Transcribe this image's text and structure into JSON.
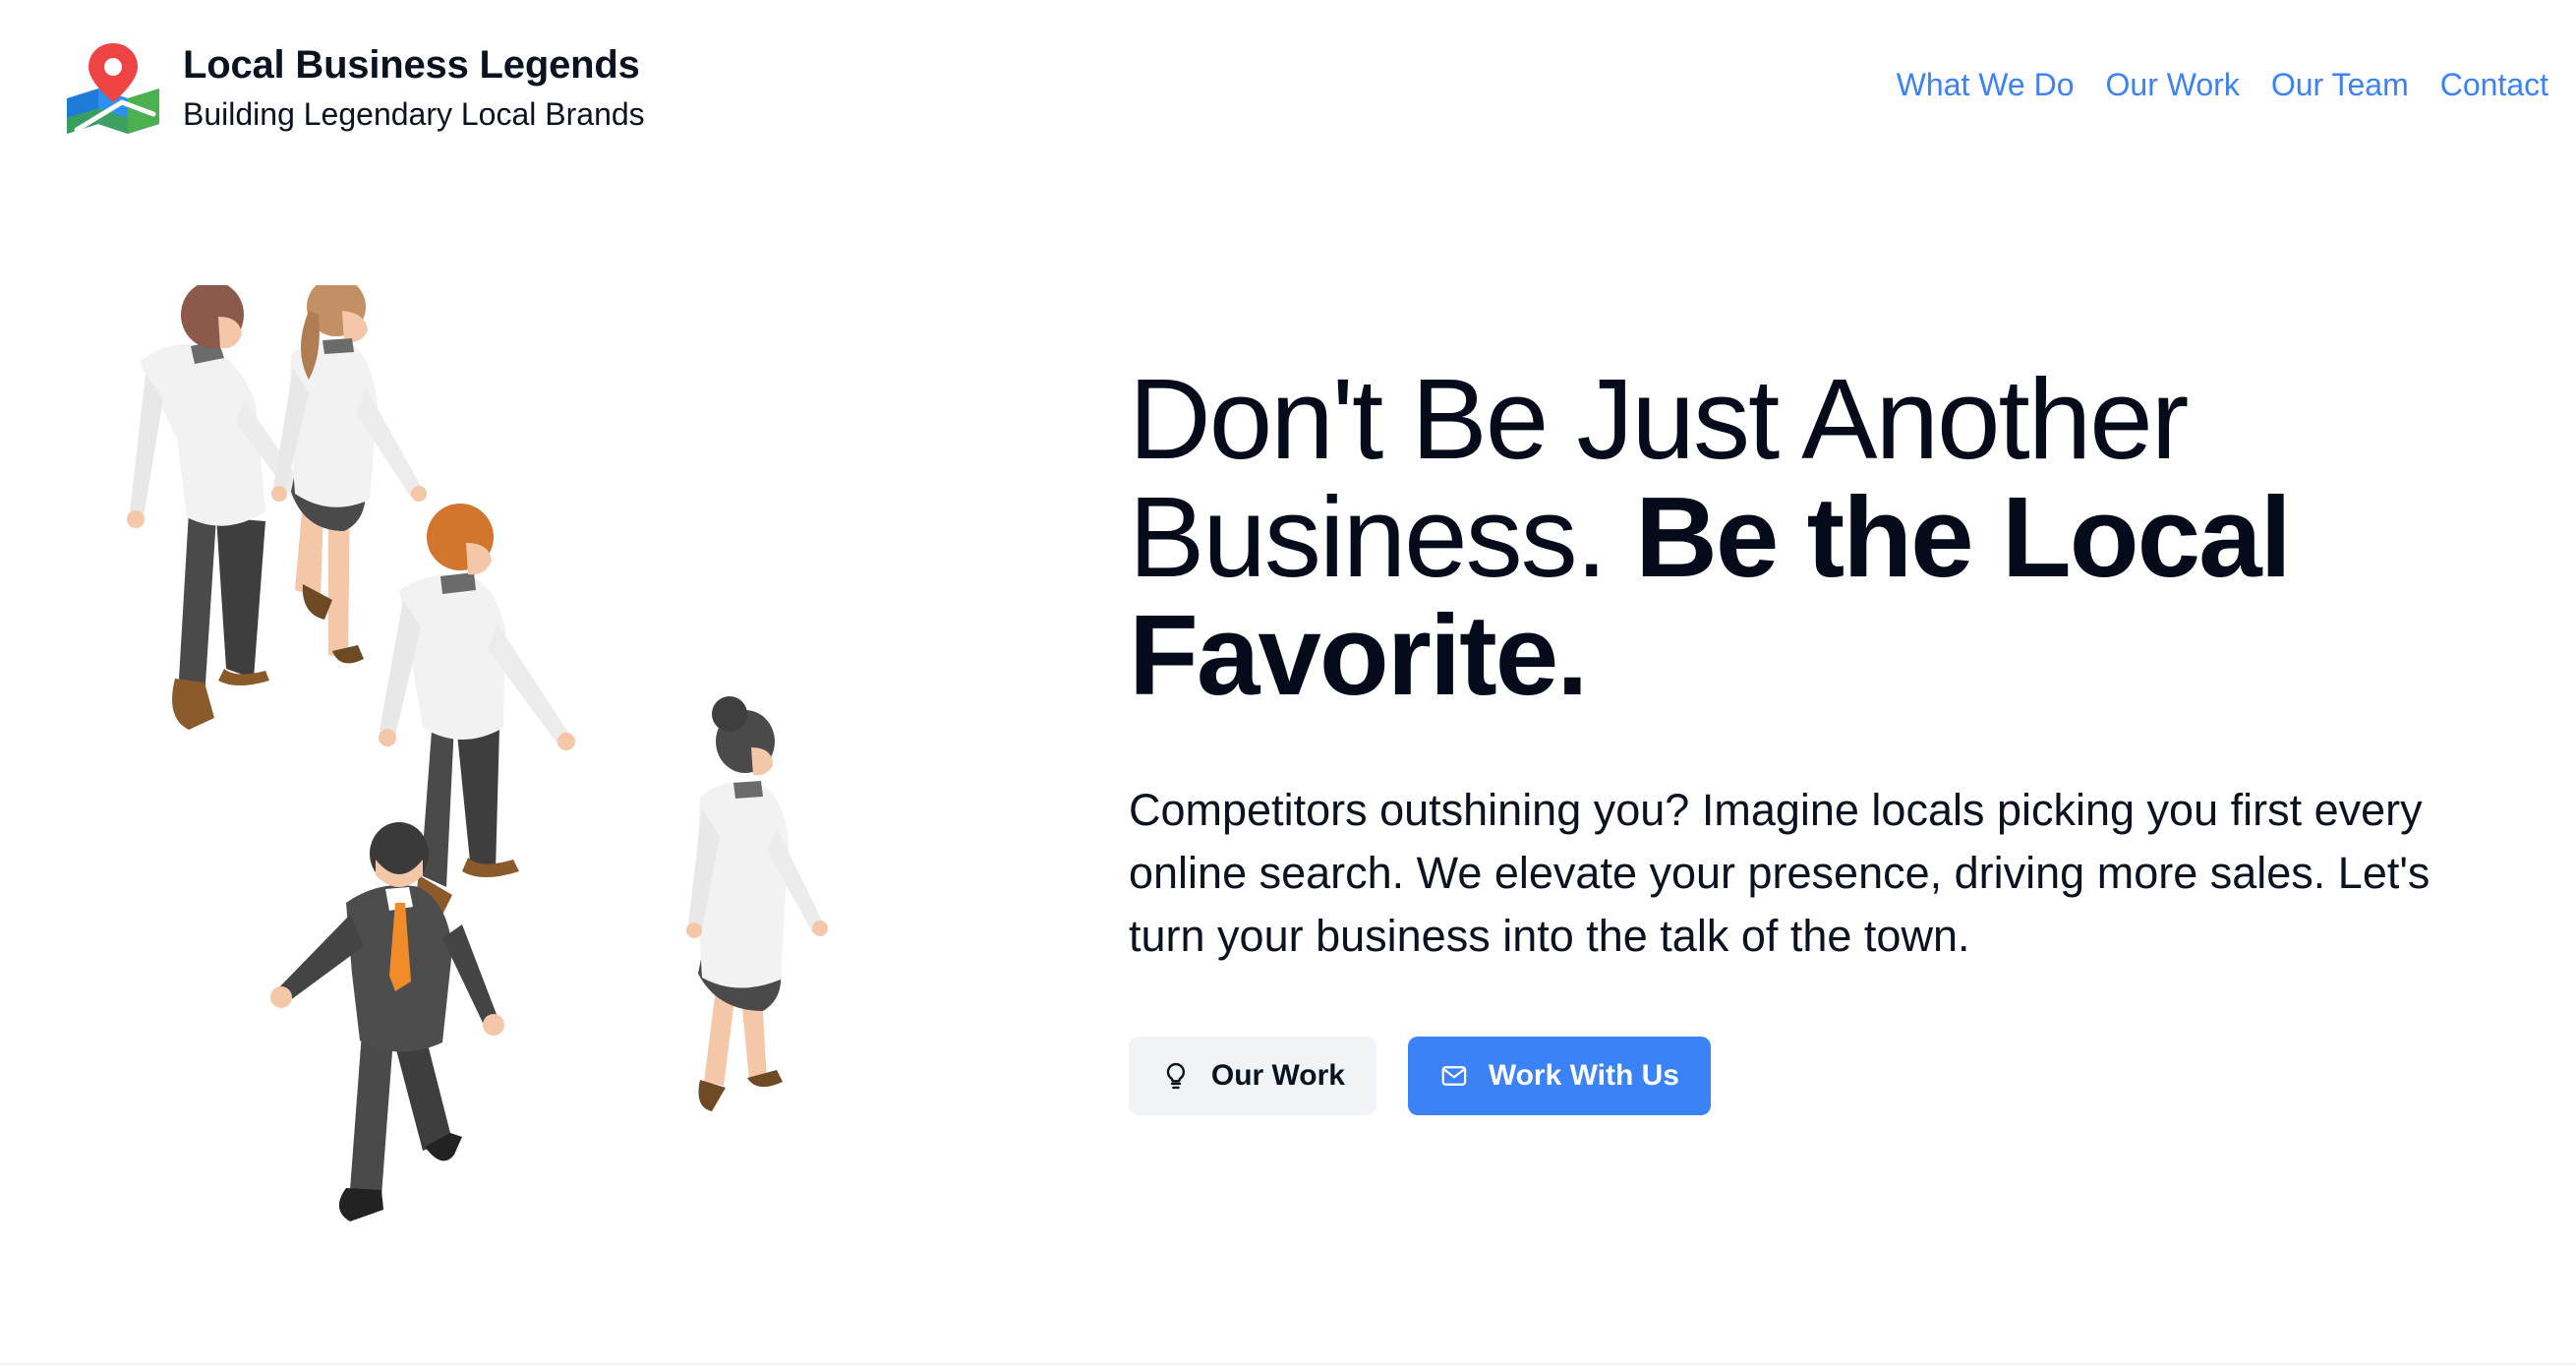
{
  "brand": {
    "title": "Local Business Legends",
    "subtitle": "Building Legendary Local Brands",
    "logo_icon": "map-pin-icon"
  },
  "nav": {
    "items": [
      {
        "label": "What We Do"
      },
      {
        "label": "Our Work"
      },
      {
        "label": "Our Team"
      },
      {
        "label": "Contact"
      }
    ]
  },
  "hero": {
    "headline_regular": "Don't Be Just Another Business.",
    "headline_bold": "Be the Local Favorite.",
    "lede": "Competitors outshining you? Imagine locals picking you first every online search. We elevate your presence, driving more sales. Let's turn your business into the talk of the town.",
    "illustration": "walking-business-people-illustration",
    "buttons": {
      "secondary_label": "Our Work",
      "secondary_icon": "lightbulb-icon",
      "primary_label": "Work With Us",
      "primary_icon": "envelope-icon"
    }
  },
  "colors": {
    "accent": "#3b82f6",
    "text": "#0b1220",
    "secondary_button_bg": "#f1f4f7"
  }
}
